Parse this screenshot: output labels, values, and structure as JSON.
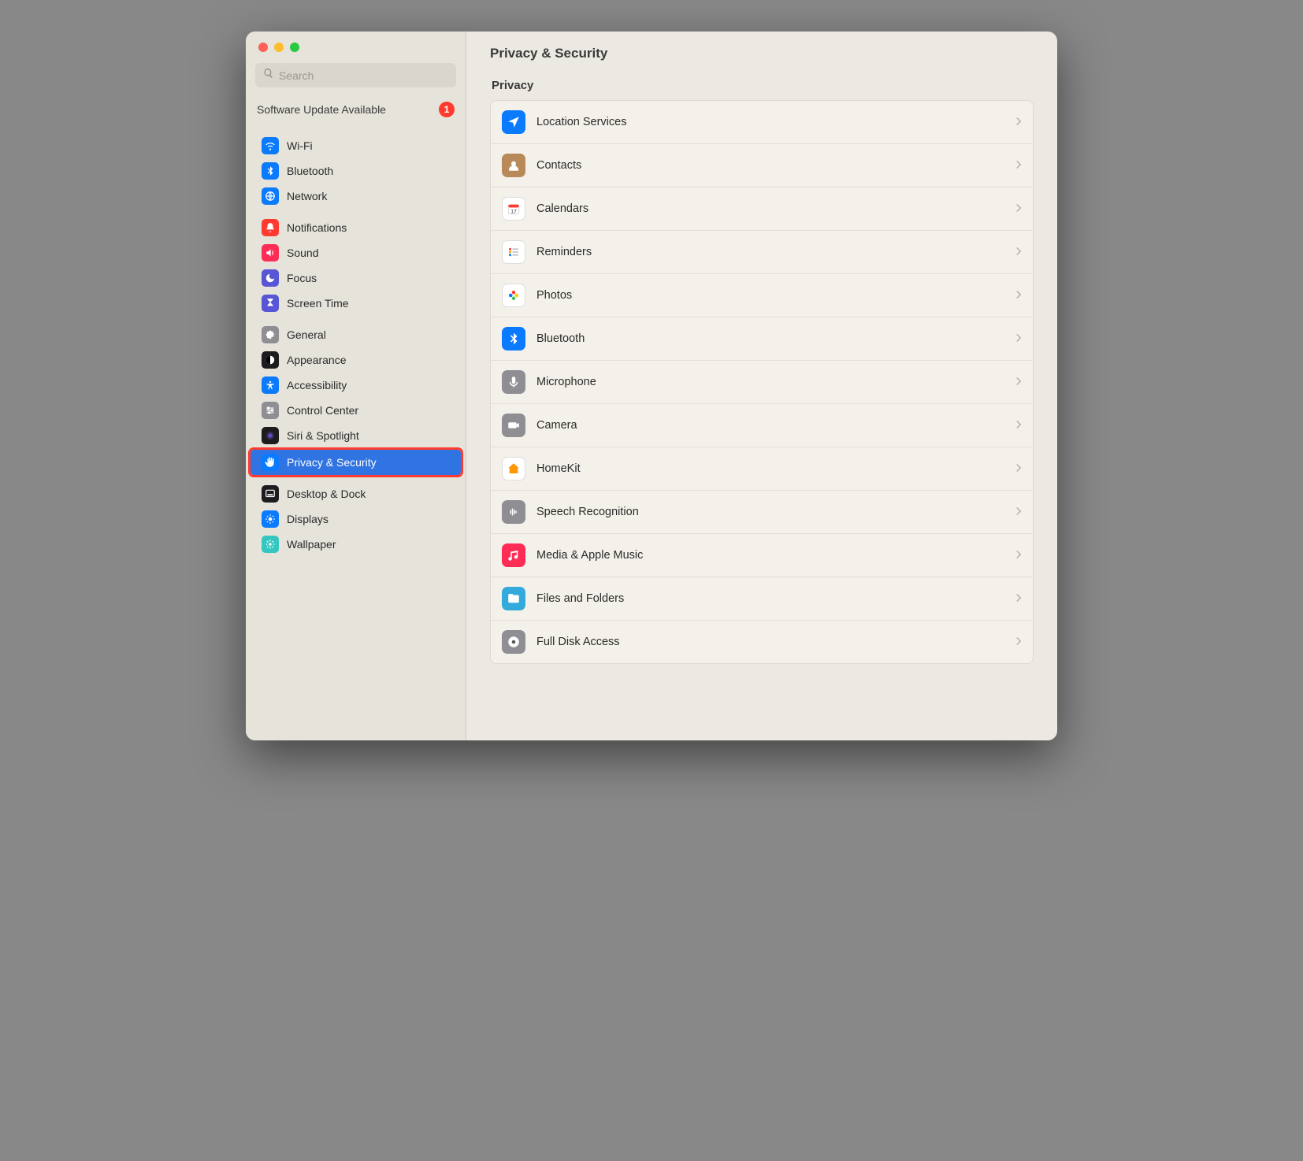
{
  "search": {
    "placeholder": "Search"
  },
  "update": {
    "label": "Software Update Available",
    "count": "1"
  },
  "header": {
    "title": "Privacy & Security"
  },
  "section": {
    "privacy_title": "Privacy"
  },
  "sidebar": {
    "groups": [
      {
        "items": [
          {
            "label": "Wi-Fi",
            "icon": "wifi",
            "bg": "#0a7aff"
          },
          {
            "label": "Bluetooth",
            "icon": "bluetooth",
            "bg": "#0a7aff"
          },
          {
            "label": "Network",
            "icon": "globe",
            "bg": "#0a7aff"
          }
        ]
      },
      {
        "items": [
          {
            "label": "Notifications",
            "icon": "bell",
            "bg": "#ff3b30"
          },
          {
            "label": "Sound",
            "icon": "speaker",
            "bg": "#ff2d55"
          },
          {
            "label": "Focus",
            "icon": "moon",
            "bg": "#5856d6"
          },
          {
            "label": "Screen Time",
            "icon": "hourglass",
            "bg": "#5856d6"
          }
        ]
      },
      {
        "items": [
          {
            "label": "General",
            "icon": "gear",
            "bg": "#8e8e93"
          },
          {
            "label": "Appearance",
            "icon": "appearance",
            "bg": "#1c1c1e"
          },
          {
            "label": "Accessibility",
            "icon": "accessibility",
            "bg": "#0a7aff"
          },
          {
            "label": "Control Center",
            "icon": "sliders",
            "bg": "#8e8e93"
          },
          {
            "label": "Siri & Spotlight",
            "icon": "siri",
            "bg": "#1c1c1e"
          },
          {
            "label": "Privacy & Security",
            "icon": "hand",
            "bg": "#0a7aff",
            "selected": true,
            "highlighted": true
          }
        ]
      },
      {
        "items": [
          {
            "label": "Desktop & Dock",
            "icon": "dock",
            "bg": "#1c1c1e"
          },
          {
            "label": "Displays",
            "icon": "display",
            "bg": "#0a7aff"
          },
          {
            "label": "Wallpaper",
            "icon": "wallpaper",
            "bg": "#34c7c2"
          }
        ]
      }
    ]
  },
  "privacy_rows": {
    "group1": [
      {
        "label": "Location Services",
        "icon": "location",
        "bg": "#0a7aff"
      },
      {
        "label": "Contacts",
        "icon": "contacts",
        "bg": "#b88a5a"
      },
      {
        "label": "Calendars",
        "icon": "calendar",
        "bg": "#ffffff"
      },
      {
        "label": "Reminders",
        "icon": "reminders",
        "bg": "#ffffff"
      },
      {
        "label": "Photos",
        "icon": "photos",
        "bg": "#ffffff"
      },
      {
        "label": "Bluetooth",
        "icon": "bluetooth",
        "bg": "#0a7aff"
      },
      {
        "label": "Microphone",
        "icon": "mic",
        "bg": "#8e8e93"
      },
      {
        "label": "Camera",
        "icon": "camera",
        "bg": "#8e8e93"
      },
      {
        "label": "HomeKit",
        "icon": "home",
        "bg": "#ffffff"
      },
      {
        "label": "Speech Recognition",
        "icon": "waveform",
        "bg": "#8e8e93"
      },
      {
        "label": "Media & Apple Music",
        "icon": "music",
        "bg": "#ff2d55"
      },
      {
        "label": "Files and Folders",
        "icon": "folder",
        "bg": "#34aadc"
      },
      {
        "label": "Full Disk Access",
        "icon": "disk",
        "bg": "#8e8e93"
      }
    ]
  }
}
